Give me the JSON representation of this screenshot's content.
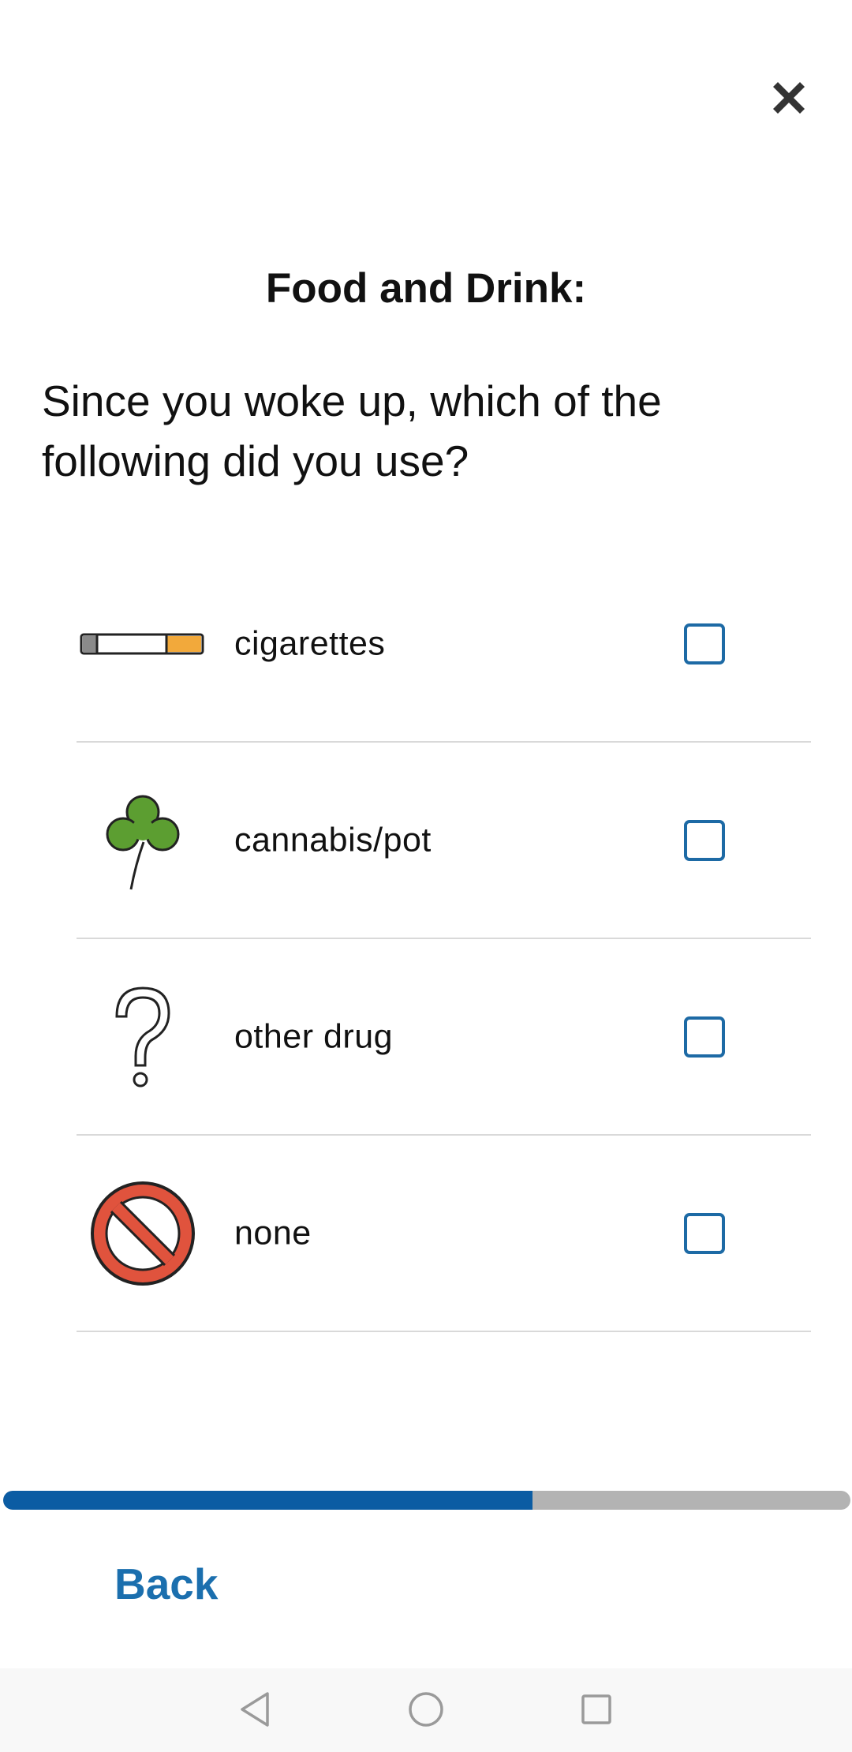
{
  "header": {
    "close_icon": "close-icon"
  },
  "section_title": "Food and Drink:",
  "question": "Since you woke up, which of the following did you use?",
  "options": [
    {
      "label": "cigarettes",
      "icon": "cigarette-icon",
      "checked": false
    },
    {
      "label": "cannabis/pot",
      "icon": "clover-icon",
      "checked": false
    },
    {
      "label": "other drug",
      "icon": "question-mark-icon",
      "checked": false
    },
    {
      "label": "none",
      "icon": "prohibited-icon",
      "checked": false
    }
  ],
  "progress": {
    "fraction": 0.625,
    "fill_color": "#0b5ca3",
    "track_color": "#b3b3b3"
  },
  "footer": {
    "back_label": "Back"
  },
  "colors": {
    "accent": "#1b6fae",
    "checkbox_border": "#1d6aa5"
  },
  "nav": {
    "back_icon": "triangle-back-icon",
    "home_icon": "circle-home-icon",
    "recents_icon": "square-recents-icon"
  }
}
